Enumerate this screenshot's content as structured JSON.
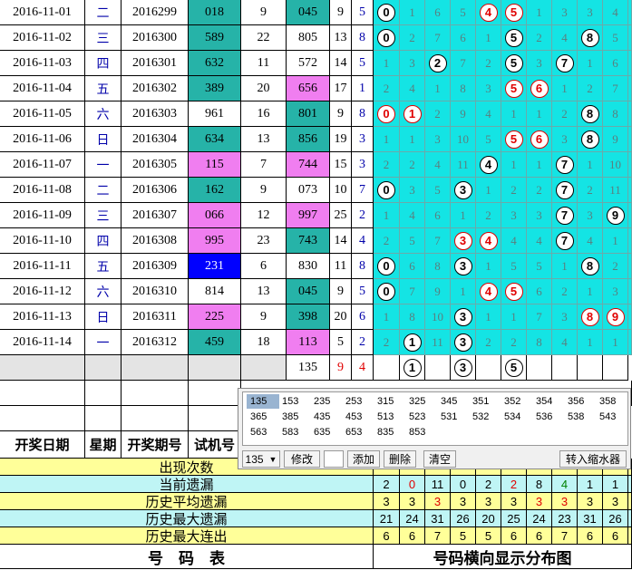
{
  "rows": [
    {
      "date": "2016-11-01",
      "weekday": "二",
      "issue": "2016299",
      "test": "018",
      "a": "9",
      "prize": "045",
      "s": "9",
      "k": "5",
      "dist": [
        "0",
        "1",
        "6",
        "5",
        "4",
        "5",
        "1",
        "3",
        "3",
        "4"
      ],
      "circ": [
        0,
        4,
        5
      ],
      "red": [
        4,
        5
      ]
    },
    {
      "date": "2016-11-02",
      "weekday": "三",
      "issue": "2016300",
      "test": "589",
      "a": "22",
      "prize": "805",
      "s": "13",
      "k": "8",
      "dist": [
        "0",
        "2",
        "7",
        "6",
        "1",
        "5",
        "2",
        "4",
        "8",
        "5"
      ],
      "circ": [
        0,
        5,
        8
      ],
      "red": []
    },
    {
      "date": "2016-11-03",
      "weekday": "四",
      "issue": "2016301",
      "test": "632",
      "a": "11",
      "prize": "572",
      "s": "14",
      "k": "5",
      "dist": [
        "1",
        "3",
        "2",
        "7",
        "2",
        "5",
        "3",
        "7",
        "1",
        "6"
      ],
      "circ": [
        2,
        5,
        7
      ],
      "red": []
    },
    {
      "date": "2016-11-04",
      "weekday": "五",
      "issue": "2016302",
      "test": "389",
      "a": "20",
      "prize": "656",
      "s": "17",
      "k": "1",
      "dist": [
        "2",
        "4",
        "1",
        "8",
        "3",
        "5",
        "6",
        "1",
        "2",
        "7"
      ],
      "circ": [
        5,
        6
      ],
      "red": [
        5,
        6
      ]
    },
    {
      "date": "2016-11-05",
      "weekday": "六",
      "issue": "2016303",
      "test": "961",
      "a": "16",
      "prize": "801",
      "s": "9",
      "k": "8",
      "dist": [
        "0",
        "1",
        "2",
        "9",
        "4",
        "1",
        "1",
        "2",
        "8",
        "8"
      ],
      "circ": [
        0,
        1,
        8
      ],
      "red": [
        0,
        1
      ]
    },
    {
      "date": "2016-11-06",
      "weekday": "日",
      "issue": "2016304",
      "test": "634",
      "a": "13",
      "prize": "856",
      "s": "19",
      "k": "3",
      "dist": [
        "1",
        "1",
        "3",
        "10",
        "5",
        "5",
        "6",
        "3",
        "8",
        "9"
      ],
      "circ": [
        5,
        6,
        8
      ],
      "red": [
        5,
        6
      ]
    },
    {
      "date": "2016-11-07",
      "weekday": "一",
      "issue": "2016305",
      "test": "115",
      "a": "7",
      "prize": "744",
      "s": "15",
      "k": "3",
      "dist": [
        "2",
        "2",
        "4",
        "11",
        "4",
        "1",
        "1",
        "7",
        "1",
        "10"
      ],
      "circ": [
        4,
        7
      ],
      "red": []
    },
    {
      "date": "2016-11-08",
      "weekday": "二",
      "issue": "2016306",
      "test": "162",
      "a": "9",
      "prize": "073",
      "s": "10",
      "k": "7",
      "dist": [
        "0",
        "3",
        "5",
        "3",
        "1",
        "2",
        "2",
        "7",
        "2",
        "11"
      ],
      "circ": [
        0,
        3,
        7
      ],
      "red": []
    },
    {
      "date": "2016-11-09",
      "weekday": "三",
      "issue": "2016307",
      "test": "066",
      "a": "12",
      "prize": "997",
      "s": "25",
      "k": "2",
      "dist": [
        "1",
        "4",
        "6",
        "1",
        "2",
        "3",
        "3",
        "7",
        "3",
        "9"
      ],
      "circ": [
        7,
        9
      ],
      "red": []
    },
    {
      "date": "2016-11-10",
      "weekday": "四",
      "issue": "2016308",
      "test": "995",
      "a": "23",
      "prize": "743",
      "s": "14",
      "k": "4",
      "dist": [
        "2",
        "5",
        "7",
        "3",
        "4",
        "4",
        "4",
        "7",
        "4",
        "1"
      ],
      "circ": [
        3,
        4,
        7
      ],
      "red": [
        3,
        4
      ]
    },
    {
      "date": "2016-11-11",
      "weekday": "五",
      "issue": "2016309",
      "test": "231",
      "a": "6",
      "prize": "830",
      "s": "11",
      "k": "8",
      "dist": [
        "0",
        "6",
        "8",
        "3",
        "1",
        "5",
        "5",
        "1",
        "8",
        "2"
      ],
      "circ": [
        0,
        3,
        8
      ],
      "red": []
    },
    {
      "date": "2016-11-12",
      "weekday": "六",
      "issue": "2016310",
      "test": "814",
      "a": "13",
      "prize": "045",
      "s": "9",
      "k": "5",
      "dist": [
        "0",
        "7",
        "9",
        "1",
        "4",
        "5",
        "6",
        "2",
        "1",
        "3"
      ],
      "circ": [
        0,
        4,
        5
      ],
      "red": [
        4,
        5
      ]
    },
    {
      "date": "2016-11-13",
      "weekday": "日",
      "issue": "2016311",
      "test": "225",
      "a": "9",
      "prize": "398",
      "s": "20",
      "k": "6",
      "dist": [
        "1",
        "8",
        "10",
        "3",
        "1",
        "1",
        "7",
        "3",
        "8",
        "9"
      ],
      "circ": [
        3,
        8,
        9
      ],
      "red": [
        8,
        9
      ]
    },
    {
      "date": "2016-11-14",
      "weekday": "一",
      "issue": "2016312",
      "test": "459",
      "a": "18",
      "prize": "113",
      "s": "5",
      "k": "2",
      "dist": [
        "2",
        "1",
        "11",
        "3",
        "2",
        "2",
        "8",
        "4",
        "1",
        "1"
      ],
      "circ": [
        1,
        3
      ],
      "red": []
    }
  ],
  "extra_row": {
    "prize": "135",
    "s": "9",
    "k": "4",
    "circ": [
      "1",
      "3",
      "5"
    ]
  },
  "header": {
    "date": "开奖日期",
    "weekday": "星期",
    "issue": "开奖期号",
    "test": "试机号"
  },
  "stats": [
    {
      "label": "出现次数",
      "values": []
    },
    {
      "label": "当前遗漏",
      "values": [
        "2",
        "0",
        "11",
        "0",
        "2",
        "2",
        "8",
        "4",
        "1",
        "1"
      ]
    },
    {
      "label": "历史平均遗漏",
      "values": [
        "3",
        "3",
        "3",
        "3",
        "3",
        "3",
        "3",
        "3",
        "3",
        "3"
      ]
    },
    {
      "label": "历史最大遗漏",
      "values": [
        "21",
        "24",
        "31",
        "26",
        "20",
        "25",
        "24",
        "23",
        "31",
        "26"
      ]
    },
    {
      "label": "历史最大连出",
      "values": [
        "6",
        "6",
        "7",
        "5",
        "5",
        "6",
        "6",
        "7",
        "6",
        "6"
      ]
    }
  ],
  "footer": {
    "left": "号　码　表",
    "right": "号码横向显示分布图"
  },
  "popup": {
    "numbers": [
      "135",
      "153",
      "235",
      "253",
      "315",
      "325",
      "345",
      "351",
      "352",
      "354",
      "356",
      "358",
      "365",
      "385",
      "435",
      "453",
      "513",
      "523",
      "531",
      "532",
      "534",
      "536",
      "538",
      "543",
      "563",
      "583",
      "635",
      "653",
      "835",
      "853"
    ],
    "selected": "135",
    "combo_value": "135",
    "btn_modify": "修改",
    "btn_add": "添加",
    "btn_delete": "删除",
    "btn_clear": "清空",
    "btn_shrink": "转入缩水器",
    "input_value": ""
  },
  "colors": {
    "cyan": "#14e4e4",
    "teal": "#26b3a8",
    "pink": "#f07ef0",
    "blue": "#0000ff",
    "red": "#e00000"
  }
}
